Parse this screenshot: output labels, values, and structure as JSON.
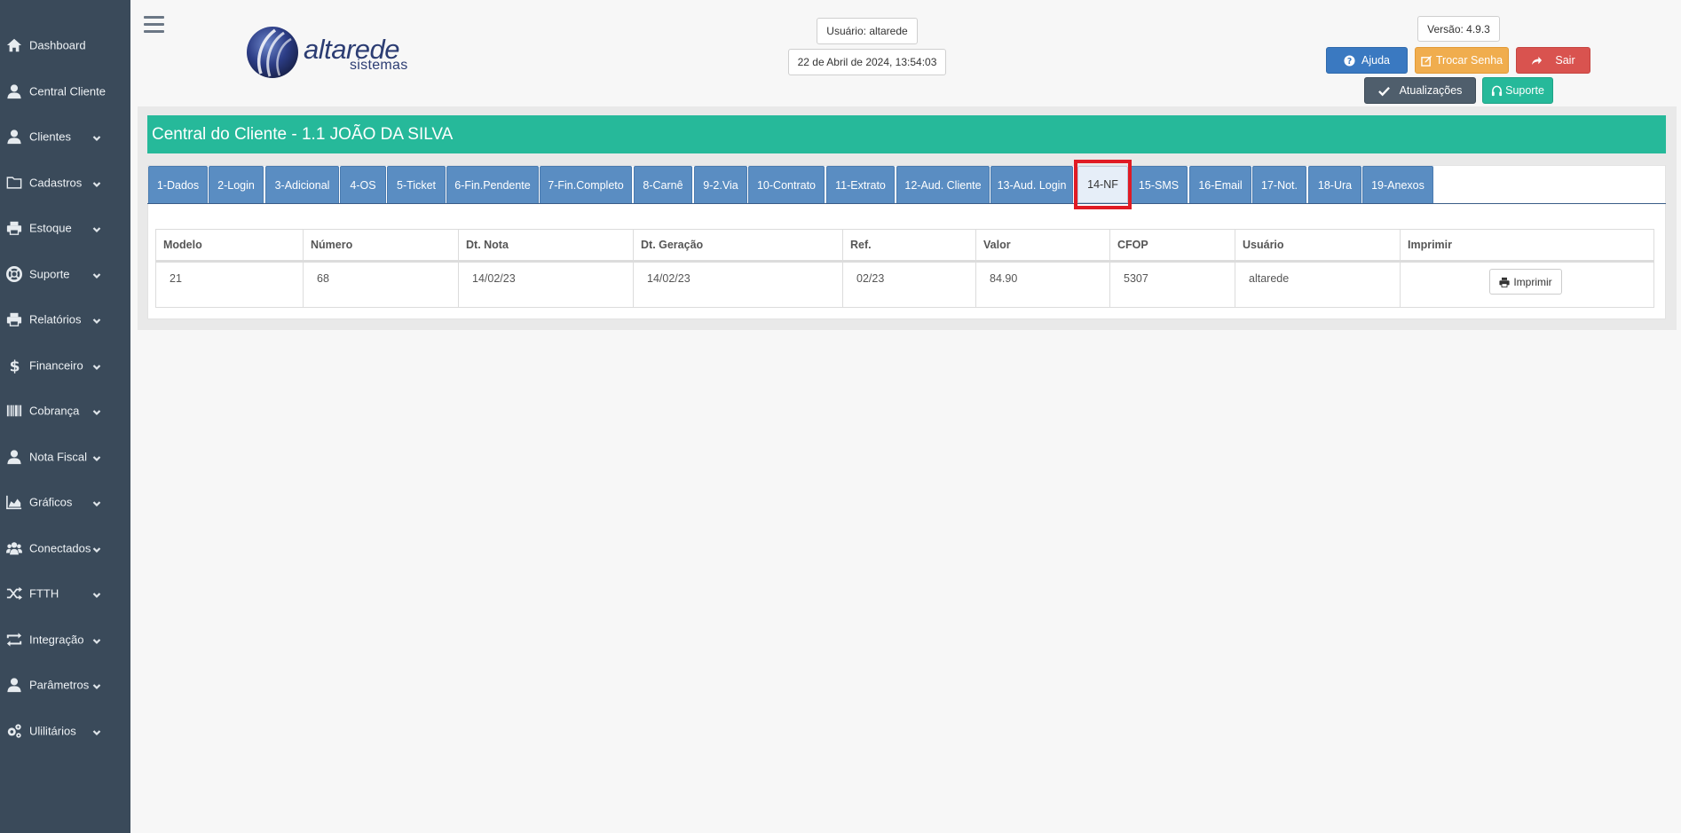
{
  "sidebar": {
    "items": [
      {
        "label": "Dashboard",
        "icon": "home-icon",
        "chevron": false
      },
      {
        "label": "Central Cliente",
        "icon": "user-icon",
        "chevron": false
      },
      {
        "label": "Clientes",
        "icon": "user-icon",
        "chevron": true
      },
      {
        "label": "Cadastros",
        "icon": "folder-icon",
        "chevron": true
      },
      {
        "label": "Estoque",
        "icon": "print-icon",
        "chevron": true
      },
      {
        "label": "Suporte",
        "icon": "lifebuoy-icon",
        "chevron": true
      },
      {
        "label": "Relatórios",
        "icon": "print-icon",
        "chevron": true
      },
      {
        "label": "Financeiro",
        "icon": "dollar-icon",
        "chevron": true
      },
      {
        "label": "Cobrança",
        "icon": "barcode-icon",
        "chevron": true
      },
      {
        "label": "Nota Fiscal",
        "icon": "user-icon",
        "chevron": true
      },
      {
        "label": "Gráficos",
        "icon": "area-chart-icon",
        "chevron": true
      },
      {
        "label": "Conectados",
        "icon": "users-icon",
        "chevron": true
      },
      {
        "label": "FTTH",
        "icon": "shuffle-icon",
        "chevron": true
      },
      {
        "label": "Integração",
        "icon": "exchange-icon",
        "chevron": true
      },
      {
        "label": "Parâmetros",
        "icon": "user-icon",
        "chevron": true
      },
      {
        "label": "Ulilitários",
        "icon": "cogs-icon",
        "chevron": true
      }
    ]
  },
  "header": {
    "logo_text": "altarede",
    "logo_sub": "sistemas",
    "usuario": "Usuário: altarede",
    "datetime": "22 de Abril de 2024, 13:54:03",
    "versao": "Versão: 4.9.3",
    "btn_ajuda": "Ajuda",
    "btn_senha": "Trocar Senha",
    "btn_sair": "Sair",
    "btn_atualizacoes": "Atualizações",
    "btn_suporte": "Suporte"
  },
  "panel": {
    "title": "Central do Cliente - 1.1 JOÃO DA SILVA"
  },
  "tabs": [
    "1-Dados",
    "2-Login",
    "3-Adicional",
    "4-OS",
    "5-Ticket",
    "6-Fin.Pendente",
    "7-Fin.Completo",
    "8-Carnê",
    "9-2.Via",
    "10-Contrato",
    "11-Extrato",
    "12-Aud. Cliente",
    "13-Aud. Login",
    "14-NF",
    "15-SMS",
    "16-Email",
    "17-Not.",
    "18-Ura",
    "19-Anexos"
  ],
  "active_tab": "14-NF",
  "table": {
    "headers": [
      "Modelo",
      "Número",
      "Dt. Nota",
      "Dt. Geração",
      "Ref.",
      "Valor",
      "CFOP",
      "Usuário",
      "Imprimir"
    ],
    "rows": [
      [
        "21",
        "68",
        "14/02/23",
        "14/02/23",
        "02/23",
        "84.90",
        "5307",
        "altarede"
      ]
    ],
    "print_label": "Imprimir"
  },
  "colors": {
    "sidebar": "#3a4a5a",
    "accent": "#26b99a",
    "tab": "#5a8dc2",
    "highlight": "#e01b24"
  }
}
